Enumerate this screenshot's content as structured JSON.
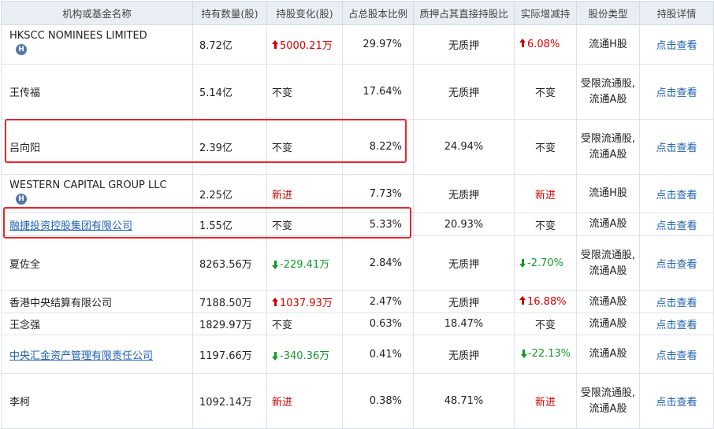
{
  "header": {
    "name": "机构或基金名称",
    "shares": "持有数量(股)",
    "change": "持股变化(股)",
    "ratio": "占总股本比例",
    "pledge": "质押占其直接持股比",
    "actual": "实际增减持",
    "type": "股份类型",
    "detail": "持股详情"
  },
  "rows": [
    {
      "name": "HKSCC NOMINEES LIMITED",
      "badge": "H",
      "shares": "8.72亿",
      "change": "5000.21万",
      "ratio": "29.97%",
      "pledge": "无质押",
      "actual": "6.08%",
      "type": "流通H股",
      "detail": "点击查看"
    },
    {
      "name": "王传福",
      "shares": "5.14亿",
      "change": "不变",
      "ratio": "17.64%",
      "pledge": "无质押",
      "actual": "不变",
      "type": "受限流通股,流通A股",
      "detail": "点击查看"
    },
    {
      "name": "吕向阳",
      "shares": "2.39亿",
      "change": "不变",
      "ratio": "8.22%",
      "pledge": "24.94%",
      "actual": "不变",
      "type": "受限流通股,流通A股",
      "detail": "点击查看"
    },
    {
      "name": "WESTERN CAPITAL GROUP LLC",
      "badge": "H",
      "shares": "2.25亿",
      "change": "新进",
      "ratio": "7.73%",
      "pledge": "无质押",
      "actual": "新进",
      "type": "流通H股",
      "detail": "点击查看"
    },
    {
      "name": "融捷投资控股集团有限公司",
      "shares": "1.55亿",
      "change": "不变",
      "ratio": "5.33%",
      "pledge": "20.93%",
      "actual": "不变",
      "type": "流通A股",
      "detail": "点击查看"
    },
    {
      "name": "夏佐全",
      "shares": "8263.56万",
      "change": "-229.41万",
      "ratio": "2.84%",
      "pledge": "无质押",
      "actual": "-2.70%",
      "type": "受限流通股,流通A股",
      "detail": "点击查看"
    },
    {
      "name": "香港中央结算有限公司",
      "shares": "7188.50万",
      "change": "1037.93万",
      "ratio": "2.47%",
      "pledge": "无质押",
      "actual": "16.88%",
      "type": "流通A股",
      "detail": "点击查看"
    },
    {
      "name": "王念强",
      "shares": "1829.97万",
      "change": "不变",
      "ratio": "0.63%",
      "pledge": "18.47%",
      "actual": "不变",
      "type": "流通A股",
      "detail": "点击查看"
    },
    {
      "name": "中央汇金资产管理有限责任公司",
      "shares": "1197.66万",
      "change": "-340.36万",
      "ratio": "0.41%",
      "pledge": "无质押",
      "actual": "-22.13%",
      "type": "流通A股",
      "detail": "点击查看"
    },
    {
      "name": "李柯",
      "shares": "1092.14万",
      "change": "新进",
      "ratio": "0.38%",
      "pledge": "48.71%",
      "actual": "新进",
      "type": "受限流通股,流通A股",
      "detail": "点击查看"
    }
  ],
  "colors": {
    "up": "#d40000",
    "down": "#119a2b",
    "link": "#1d60b0",
    "highlight": "#e8262b",
    "header_bg": "#e9eef4"
  }
}
